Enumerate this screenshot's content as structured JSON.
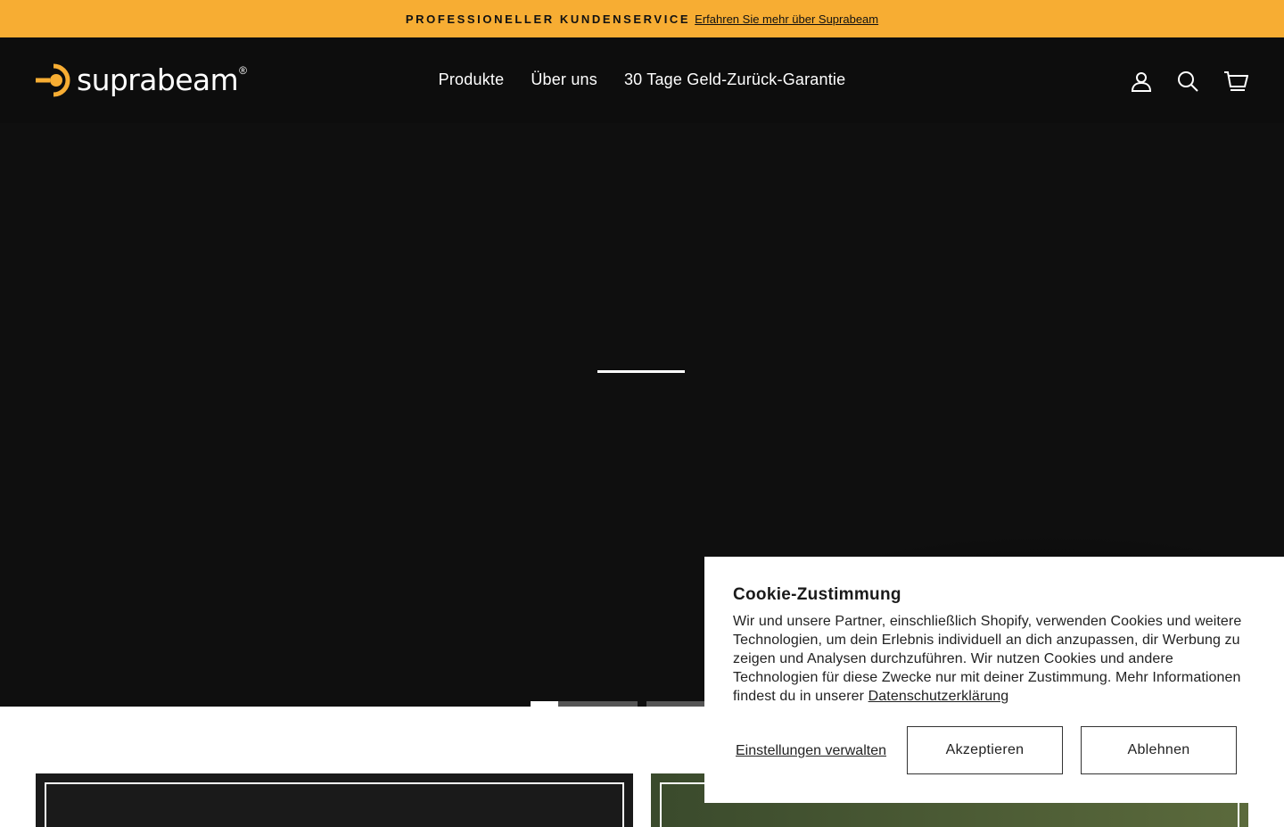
{
  "announcement": {
    "label": "PROFESSIONELLER KUNDENSERVICE",
    "link": "Erfahren Sie mehr über Suprabeam"
  },
  "brand": {
    "logo_text": "suprabeam",
    "registered": "®",
    "accent": "#f7ad33"
  },
  "nav": {
    "items": [
      {
        "label": "Produkte"
      },
      {
        "label": "Über uns"
      },
      {
        "label": "30 Tage Geld-Zurück-Garantie"
      }
    ]
  },
  "header_icons": [
    "account-icon",
    "search-icon",
    "cart-icon"
  ],
  "slider": {
    "slide_count": 3,
    "active_index": 0
  },
  "cookie": {
    "title": "Cookie-Zustimmung",
    "body": "Wir und unsere Partner, einschließlich Shopify, verwenden Cookies und weitere Technologien, um dein Erlebnis individuell an dich anzupassen, dir Werbung zu zeigen und Analysen durchzuführen. Wir nutzen Cookies und andere Technologien für diese Zwecke nur mit deiner Zustimmung. Mehr Informationen findest du in unserer",
    "policy_link": "Datenschutzerklärung",
    "manage_label": "Einstellungen verwalten",
    "accept_label": "Akzeptieren",
    "decline_label": "Ablehnen"
  }
}
